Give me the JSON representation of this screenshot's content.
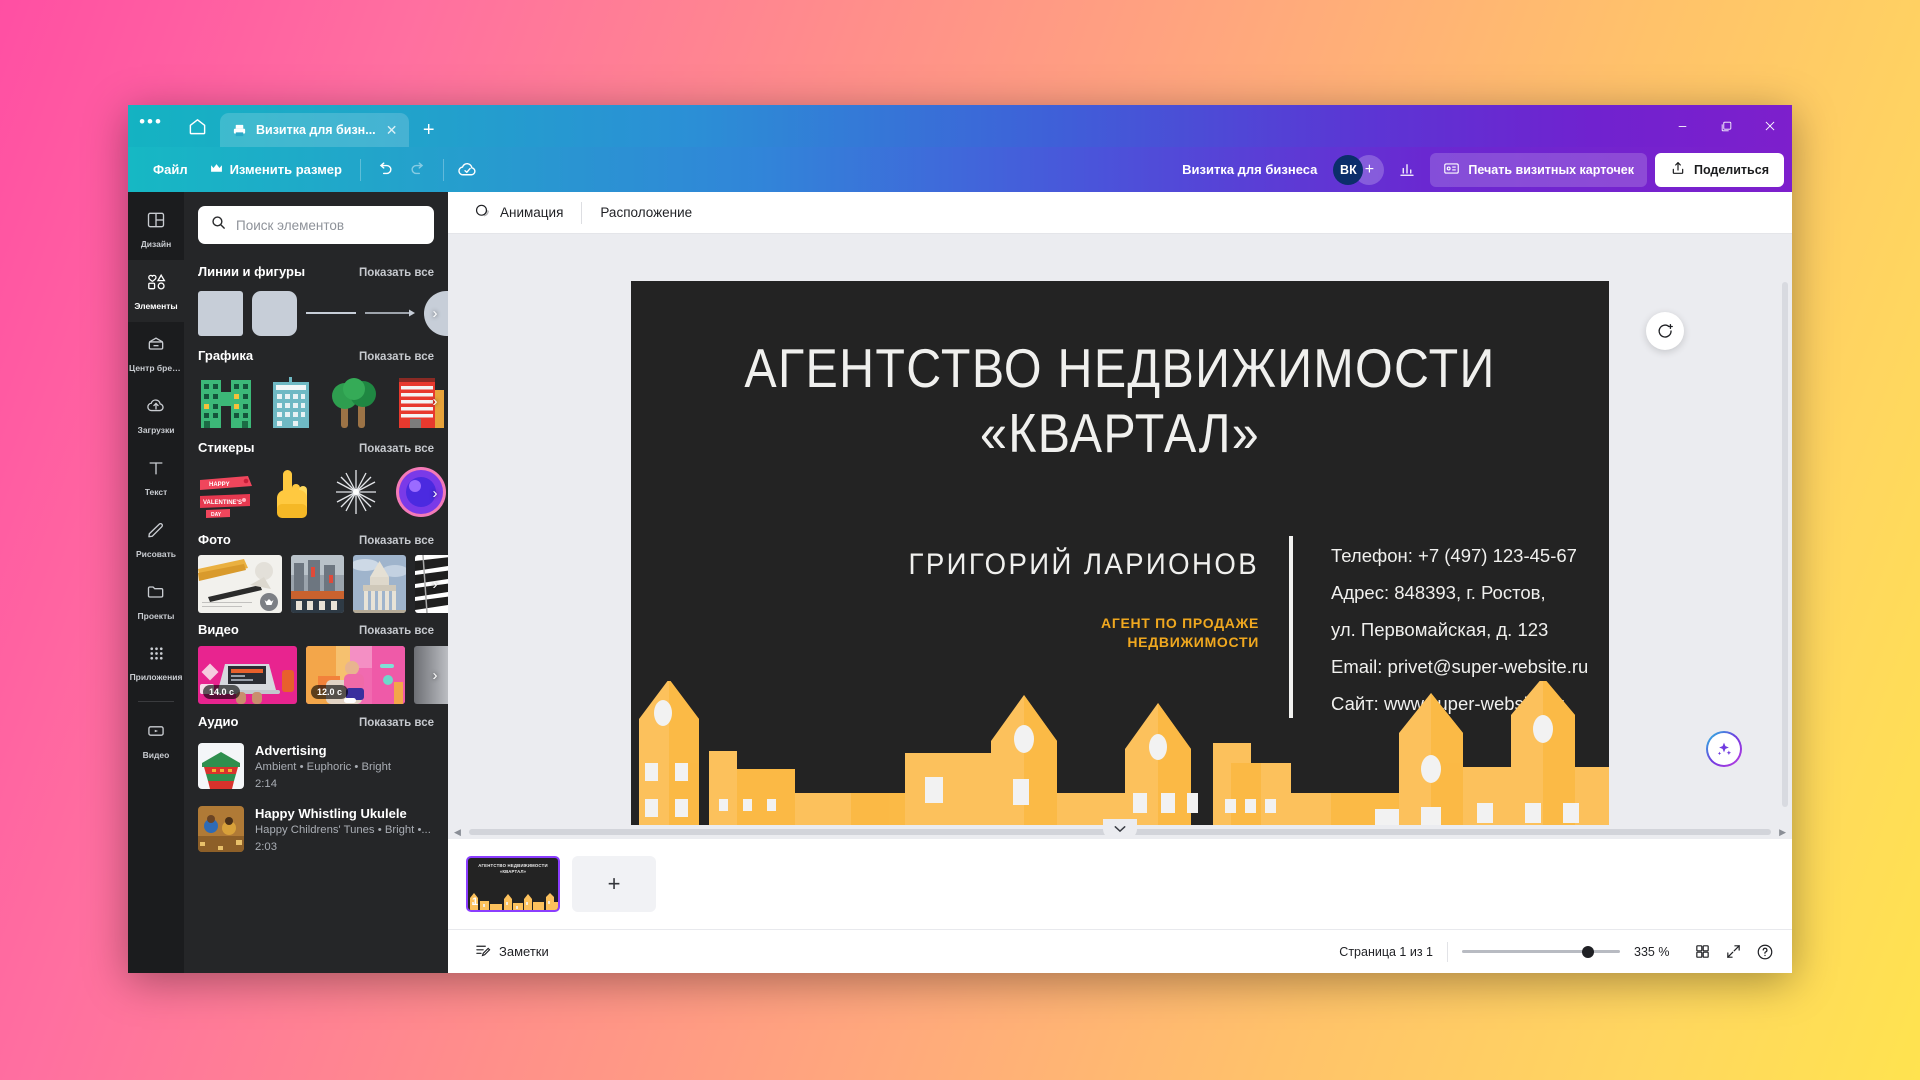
{
  "window": {
    "controls": {
      "minimize": "−",
      "restore": "❐",
      "close": "✕"
    }
  },
  "tabstrip": {
    "overflow_label": "•••",
    "home_label": "home-icon",
    "tab": {
      "title": "Визитка для бизн...",
      "close": "✕"
    },
    "new_tab": "+"
  },
  "toolbar": {
    "file": "Файл",
    "resize": "Изменить размер",
    "undo": "undo-icon",
    "redo": "redo-icon",
    "cloud": "cloud-saved-icon",
    "doc_name": "Визитка для бизнеса",
    "avatar_initials": "ВК",
    "avatar_add": "+",
    "stats": "stats-icon",
    "print_label": "Печать визитных карточек",
    "share_label": "Поделиться"
  },
  "rail": {
    "items": [
      {
        "label": "Дизайн",
        "icon": "layout-icon",
        "active": false
      },
      {
        "label": "Элементы",
        "icon": "shapes-icon",
        "active": true
      },
      {
        "label": "Центр брен...",
        "icon": "brand-icon",
        "active": false
      },
      {
        "label": "Загрузки",
        "icon": "upload-cloud-icon",
        "active": false
      },
      {
        "label": "Текст",
        "icon": "text-icon",
        "active": false
      },
      {
        "label": "Рисовать",
        "icon": "pencil-icon",
        "active": false
      },
      {
        "label": "Проекты",
        "icon": "folder-icon",
        "active": false
      },
      {
        "label": "Приложения",
        "icon": "grid-apps-icon",
        "active": false
      },
      {
        "label": "Видео",
        "icon": "video-icon",
        "active": false
      }
    ]
  },
  "panel": {
    "search_placeholder": "Поиск элементов",
    "search_value": "",
    "show_all": "Показать все",
    "sections": {
      "lines": "Линии и фигуры",
      "graphics": "Графика",
      "stickers": "Стикеры",
      "photos": "Фото",
      "videos": "Видео",
      "audio": "Аудио"
    },
    "video_durations": [
      "14.0 с",
      "12.0 с"
    ],
    "sticker_label": "HAPPY VALENTINE'S DAY",
    "audio": [
      {
        "name": "Advertising",
        "meta": "Ambient • Euphoric • Bright",
        "duration": "2:14"
      },
      {
        "name": "Happy Whistling Ukulele",
        "meta": "Happy Childrens' Tunes • Bright •...",
        "duration": "2:03"
      }
    ],
    "collapse": "‹"
  },
  "canvas_toolbar": {
    "animation": "Анимация",
    "position": "Расположение"
  },
  "card": {
    "title_line1": "АГЕНТСТВО НЕДВИЖИМОСТИ",
    "title_line2": "«КВАРТАЛ»",
    "person_name": "ГРИГОРИЙ ЛАРИОНОВ",
    "person_role_line1": "АГЕНТ ПО ПРОДАЖЕ",
    "person_role_line2": "НЕДВИЖИМОСТИ",
    "contacts": [
      "Телефон: +7 (497) 123-45-67",
      "Адрес: 848393, г. Ростов,",
      "ул. Первомайская, д. 123",
      "Email: privet@super-website.ru",
      "Сайт: www.super-website.ru"
    ],
    "colors": {
      "background": "#232323",
      "text": "#f0f0ee",
      "accent": "#f0a81f",
      "building": "#fcc15c",
      "building_alt": "#fbb944",
      "window": "#f2f2f2"
    }
  },
  "fab": {
    "comment": "add-comment-icon",
    "magic": "magic-sparkle-icon"
  },
  "pages": {
    "thumb_title_line1": "АГЕНТСТВО НЕДВИЖИМОСТИ",
    "thumb_title_line2": "«КВАРТАЛ»",
    "page_number": "1",
    "add_page": "+"
  },
  "status": {
    "notes": "Заметки",
    "page_indicator": "Страница 1 из 1",
    "zoom": "335 %",
    "grid_icon": "grid-view-icon",
    "fullscreen_icon": "fullscreen-icon",
    "help_icon": "help-icon"
  }
}
